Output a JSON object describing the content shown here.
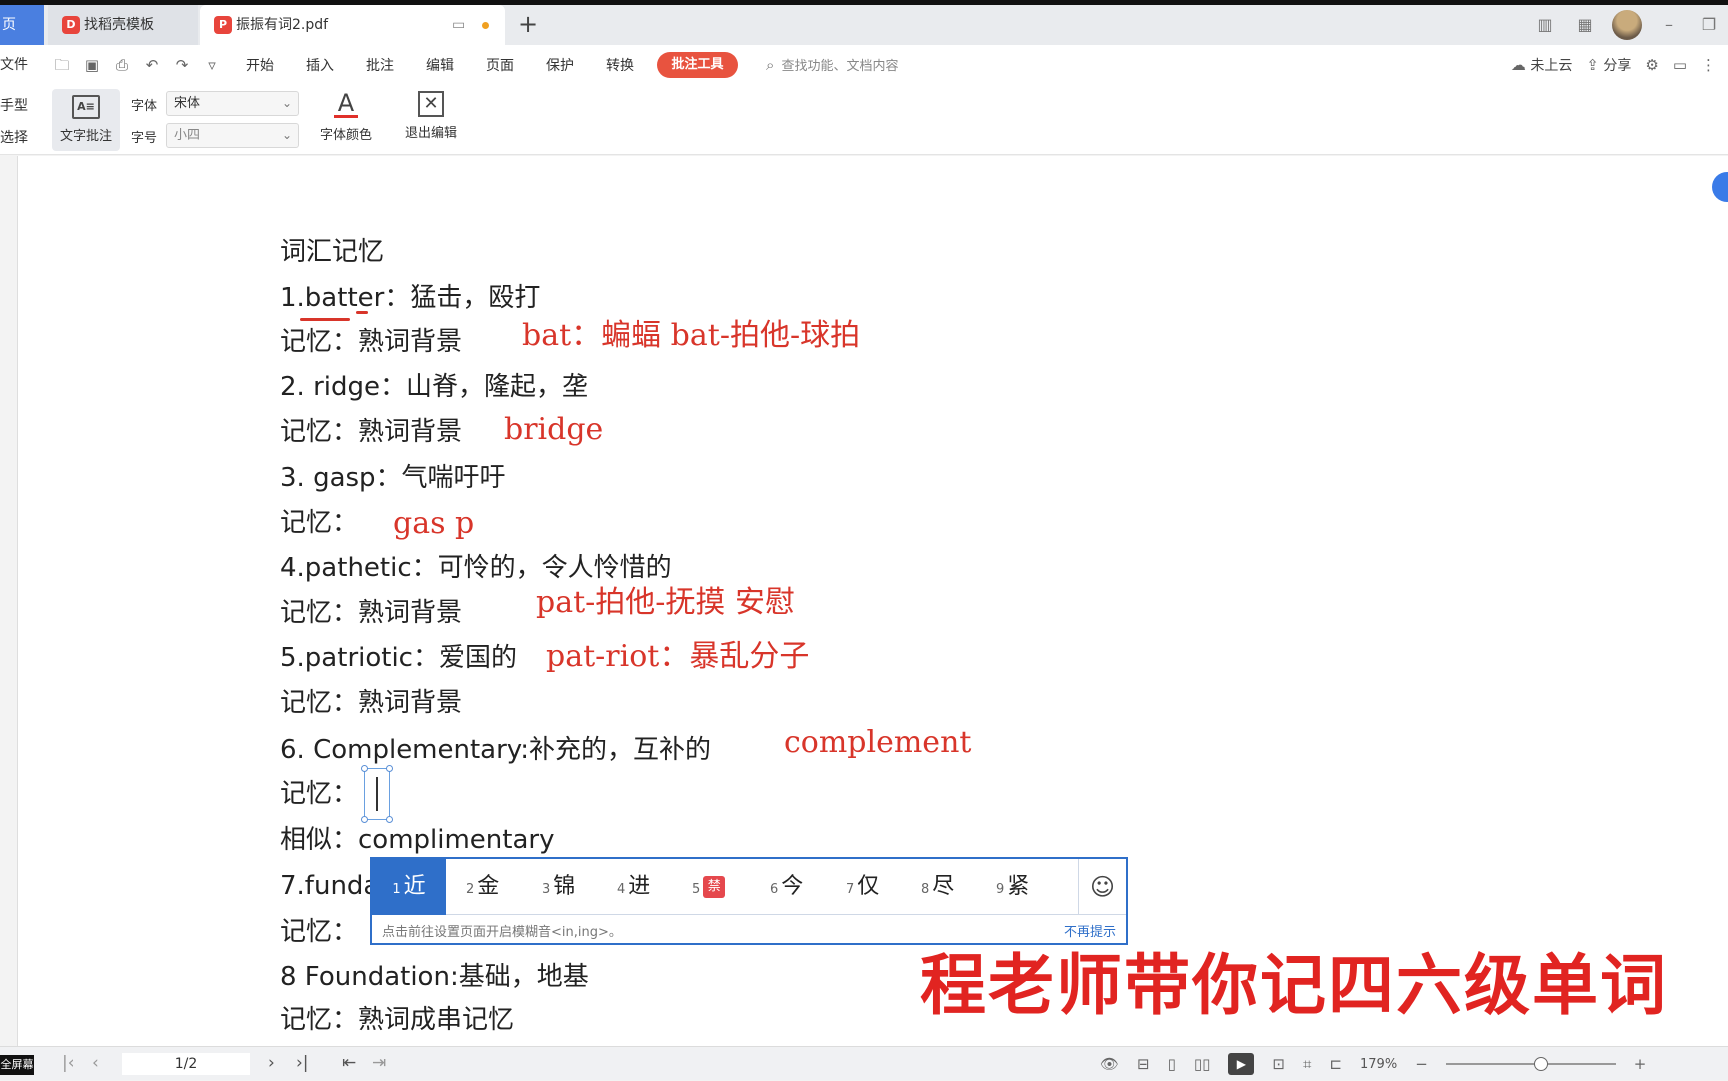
{
  "tabs": {
    "home_label": "页",
    "tab1_label": "找稻壳模板",
    "tab2_label": "振振有词2.pdf",
    "add_label": "+"
  },
  "menubar": {
    "file_label": "文件",
    "items": [
      "开始",
      "插入",
      "批注",
      "编辑",
      "页面",
      "保护",
      "转换"
    ],
    "active_label": "批注工具",
    "search_placeholder": "查找功能、文档内容",
    "cloud_label": "未上云",
    "share_label": "分享"
  },
  "ribbon": {
    "hand_label": "手型",
    "select_label": "选择",
    "textnote_label": "文字批注",
    "font_label": "字体",
    "font_value": "宋体",
    "size_label": "字号",
    "size_value": "小四",
    "fontcolor_label": "字体颜色",
    "exit_label": "退出编辑"
  },
  "document": {
    "heading": "词汇记忆",
    "lines": [
      "1.batter：猛击，殴打",
      "记忆：熟词背景",
      "2.  ridge：山脊，隆起，垄",
      "记忆：熟词背景",
      "3.  gasp：气喘吁吁",
      "记忆：",
      "4.pathetic：可怜的，令人怜惜的",
      "记忆：熟词背景",
      "5.patriotic：爱国的",
      "记忆：熟词背景",
      "6.  Complementary:补充的，互补的",
      "记忆：",
      "相似：complimentary",
      "7.funda",
      "记忆：",
      "8 Foundation:基础，地基",
      "记忆：熟词成串记忆"
    ],
    "annotations": [
      "bat：蝙蝠   bat-拍他-球拍",
      "bridge",
      "gas p",
      "pat-拍他-抚摸 安慰",
      "pat-riot：暴乱分子",
      "complement"
    ]
  },
  "ime": {
    "candidates": [
      {
        "n": "1",
        "text": "近"
      },
      {
        "n": "2",
        "text": "金"
      },
      {
        "n": "3",
        "text": "锦"
      },
      {
        "n": "4",
        "text": "进"
      },
      {
        "n": "5",
        "text": "禁"
      },
      {
        "n": "6",
        "text": "今"
      },
      {
        "n": "7",
        "text": "仅"
      },
      {
        "n": "8",
        "text": "尽"
      },
      {
        "n": "9",
        "text": "紧"
      }
    ],
    "tip": "点击前往设置页面开启模糊音<in,ing>。",
    "dismiss": "不再提示"
  },
  "banner": "程老师带你记四六级单词",
  "statusbar": {
    "fullscreen_label": "全屏幕",
    "page": "1/2",
    "zoom": "179%"
  },
  "colors": {
    "accent_blue": "#2f6fc9",
    "annotation_red": "#d8352a",
    "menu_active": "#e8533f"
  }
}
